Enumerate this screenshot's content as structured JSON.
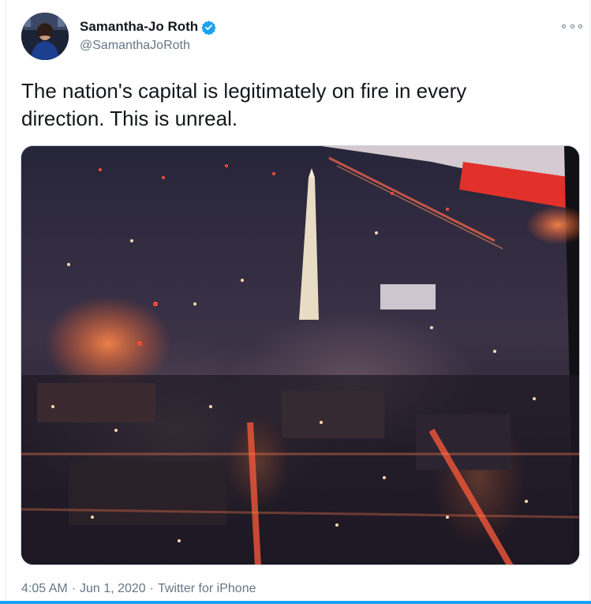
{
  "user": {
    "display_name": "Samantha-Jo Roth",
    "handle": "@SamanthaJoRoth",
    "verified": true,
    "avatar_icon": "profile-photo"
  },
  "tweet": {
    "text": "The nation's capital is legitimately on fire in every\ndirection. This is unreal."
  },
  "meta": {
    "time": "4:05 AM",
    "date": "Jun 1, 2020",
    "source": "Twitter for iPhone",
    "separator": "·"
  },
  "icons": {
    "more": "more-options-icon",
    "verified": "verified-badge-icon"
  },
  "colors": {
    "text": "#14171a",
    "secondary": "#657786",
    "accent": "#1da1f2"
  }
}
